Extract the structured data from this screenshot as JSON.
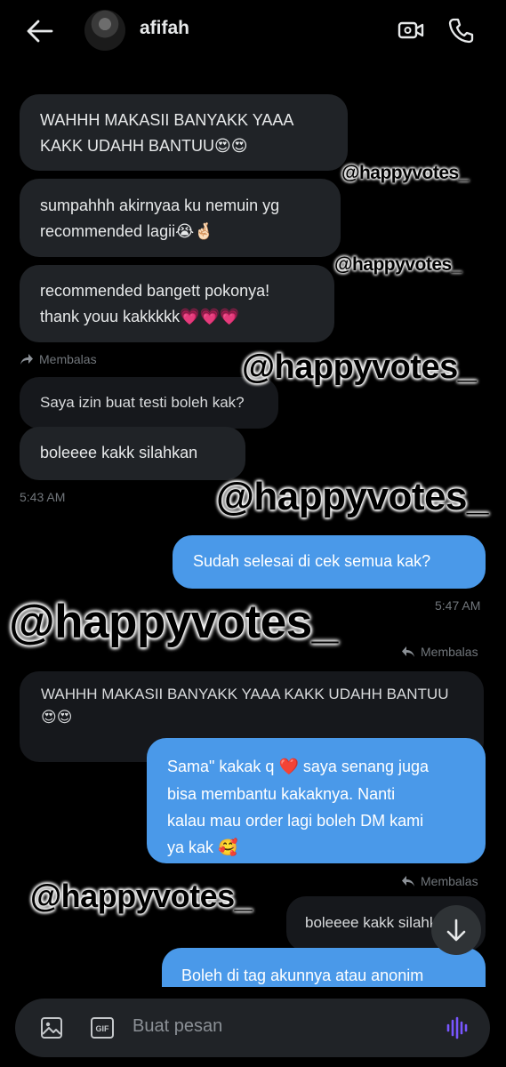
{
  "header": {
    "contact_name": "afifah"
  },
  "watermark": "@happyvotes_",
  "messages": {
    "m1_line1": "WAHHH MAKASII BANYAKK YAAA",
    "m1_line2": "KAKK UDAHH BANTUU",
    "m1_emoji": "😍😍",
    "m2_line1": "sumpahhh akirnyaa ku nemuin yg",
    "m2_line2": "recommended lagii",
    "m2_emoji": "😭🤞🏻",
    "m3_line1": "recommended bangett pokonya!",
    "m3_line2": "thank youu kakkkkk",
    "m3_emoji": "💗💗💗",
    "reply1_label": "Membalas",
    "quote1": "Saya izin buat testi boleh kak?",
    "m4": "boleeee kakk silahkan",
    "time1": "5:43 AM",
    "sent1": "Sudah selesai di cek semua kak?",
    "time2": "5:47 AM",
    "reply2_label": "Membalas",
    "quote2_line1": "WAHHH MAKASII BANYAKK YAAA KAKK UDAHH BANTUU",
    "quote2_emoji": "😍😍",
    "sent2_line1": "Sama\" kakak q",
    "sent2_heart": "❤️",
    "sent2_line1b": "saya senang juga",
    "sent2_line2": "bisa membantu kakaknya. Nanti",
    "sent2_line3": "kalau mau order lagi boleh DM kami",
    "sent2_line4": "ya kak",
    "sent2_emoji": "🥰",
    "reply3_label": "Membalas",
    "quote3": "boleeee kakk silahkan",
    "sent3": "Boleh di tag akunnya atau anonim"
  },
  "composer": {
    "placeholder": "Buat pesan"
  },
  "colors": {
    "background": "#000000",
    "received": "#202327",
    "sent": "#4a99e9",
    "meta": "#71767b",
    "voice": "#7856ff"
  }
}
